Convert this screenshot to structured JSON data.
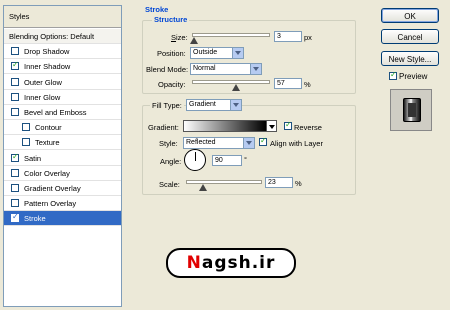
{
  "styles_panel": {
    "header": "Styles",
    "items": [
      {
        "label": "Blending Options: Default",
        "has_checkbox": false,
        "checked": false,
        "selected": false
      },
      {
        "label": "Drop Shadow",
        "has_checkbox": true,
        "checked": false,
        "selected": false
      },
      {
        "label": "Inner Shadow",
        "has_checkbox": true,
        "checked": true,
        "selected": false
      },
      {
        "label": "Outer Glow",
        "has_checkbox": true,
        "checked": false,
        "selected": false
      },
      {
        "label": "Inner Glow",
        "has_checkbox": true,
        "checked": false,
        "selected": false
      },
      {
        "label": "Bevel and Emboss",
        "has_checkbox": true,
        "checked": false,
        "selected": false
      },
      {
        "label": "Contour",
        "has_checkbox": true,
        "checked": false,
        "selected": false,
        "indent": true
      },
      {
        "label": "Texture",
        "has_checkbox": true,
        "checked": false,
        "selected": false,
        "indent": true
      },
      {
        "label": "Satin",
        "has_checkbox": true,
        "checked": true,
        "selected": false
      },
      {
        "label": "Color Overlay",
        "has_checkbox": true,
        "checked": false,
        "selected": false
      },
      {
        "label": "Gradient Overlay",
        "has_checkbox": true,
        "checked": false,
        "selected": false
      },
      {
        "label": "Pattern Overlay",
        "has_checkbox": true,
        "checked": false,
        "selected": false
      },
      {
        "label": "Stroke",
        "has_checkbox": true,
        "checked": true,
        "selected": true
      }
    ]
  },
  "stroke": {
    "title": "Stroke",
    "structure_title": "Structure",
    "size_label": "Size:",
    "size_value": "3",
    "size_unit": "px",
    "size_level": 0.03,
    "position_label": "Position:",
    "position_value": "Outside",
    "blend_mode_label": "Blend Mode:",
    "blend_mode_value": "Normal",
    "opacity_label": "Opacity:",
    "opacity_value": "57",
    "opacity_unit": "%",
    "opacity_level": 0.57,
    "fill_type_label": "Fill Type:",
    "fill_type_value": "Gradient",
    "gradient_label": "Gradient:",
    "reverse_label": "Reverse",
    "reverse_checked": true,
    "style_label": "Style:",
    "style_value": "Reflected",
    "align_label": "Align with Layer",
    "align_checked": true,
    "angle_label": "Angle:",
    "angle_value": "90",
    "angle_unit": "°",
    "scale_label": "Scale:",
    "scale_value": "23",
    "scale_unit": "%",
    "scale_level": 0.23
  },
  "buttons": {
    "ok": "OK",
    "cancel": "Cancel",
    "new_style": "New Style...",
    "preview_label": "Preview",
    "preview_checked": true
  },
  "watermark": {
    "text_red": "N",
    "text_rest": "agsh.ir"
  },
  "colors": {
    "selection": "#316ac5",
    "group_title": "#0046d5",
    "background": "#ece9d8"
  }
}
